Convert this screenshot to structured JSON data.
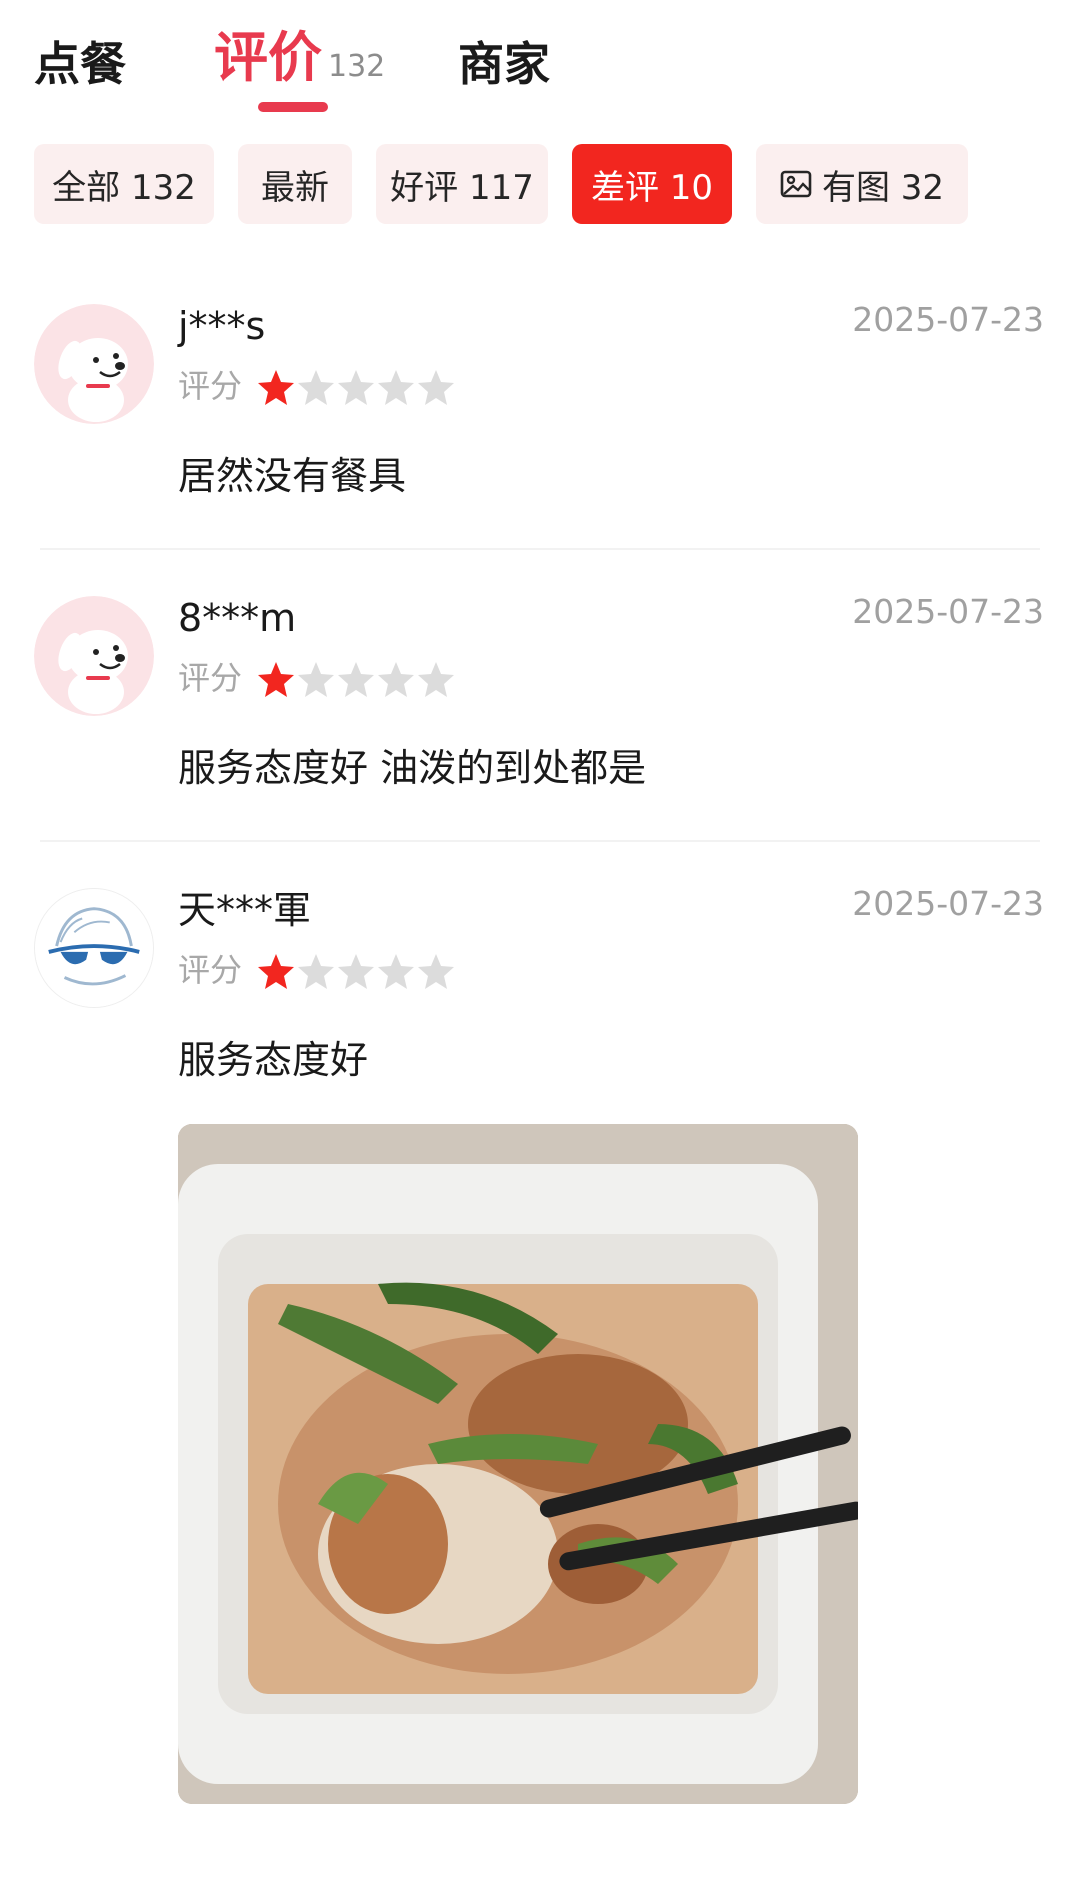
{
  "tabs": [
    {
      "label": "点餐"
    },
    {
      "label": "评价",
      "count": "132"
    },
    {
      "label": "商家"
    }
  ],
  "filters": [
    {
      "label": "全部 132"
    },
    {
      "label": "最新"
    },
    {
      "label": "好评 117"
    },
    {
      "label": "差评 10"
    },
    {
      "label": "有图 32",
      "icon": "image-icon"
    }
  ],
  "active_filter": "差评 10",
  "colors": {
    "accent": "#e83a4e",
    "chip_active": "#f2261f",
    "star_on": "#f2261f",
    "star_off": "#dcdcdc"
  },
  "reviews": [
    {
      "user": "j***s",
      "date": "2025-07-23",
      "rating_label": "评分",
      "rating": 1,
      "max_rating": 5,
      "comment": "居然没有餐具",
      "avatar": "joy-dog-avatar"
    },
    {
      "user": "8***m",
      "date": "2025-07-23",
      "rating_label": "评分",
      "rating": 1,
      "max_rating": 5,
      "comment": "服务态度好 油泼的到处都是",
      "avatar": "joy-dog-avatar"
    },
    {
      "user": "天***軍",
      "date": "2025-07-23",
      "rating_label": "评分",
      "rating": 1,
      "max_rating": 5,
      "comment": "服务态度好",
      "avatar": "sunglasses-avatar",
      "has_photo": true
    }
  ]
}
